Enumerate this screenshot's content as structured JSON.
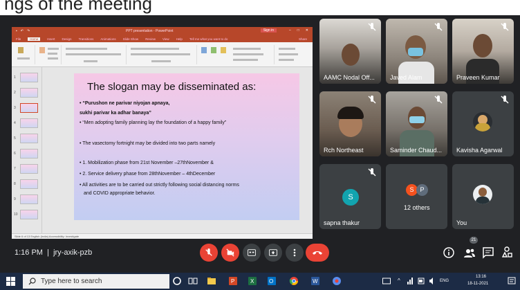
{
  "top_caption": "ngs of the meeting",
  "powerpoint": {
    "title": "PPT presentation - PowerPoint",
    "sign_in": "Sign in",
    "tabs": [
      "File",
      "Home",
      "Insert",
      "Design",
      "Transitions",
      "Animations",
      "Slide Show",
      "Review",
      "View",
      "Help",
      "Tell me what you want to do",
      "Share"
    ],
    "status_text": "Slide 6 of 13   English (India)   Accessibility: Investigate",
    "slide": {
      "title": "The slogan may be disseminated as:",
      "lines": [
        "• “Purushon ne parivar niyojan apnaya,",
        "sukhi parivar ka adhar banaya”",
        "• “Men adopting family planning lay the foundation of a happy family”",
        "• The vasectomy fortnight may be divided into two parts namely",
        "• 1. Mobilization phase from 21st November –27thNovember &",
        "• 2. Service delivery phase from 28thNovember – 4thDecember",
        "• All activities are to be carried out strictly following social distancing norms",
        "and COVID appropriate behavior."
      ]
    }
  },
  "participants": [
    {
      "name": "AAMC Nodal Off..."
    },
    {
      "name": "Javed Alam"
    },
    {
      "name": "Praveen Kumar"
    },
    {
      "name": "Rch Northeast"
    },
    {
      "name": "Saminder Chaud..."
    },
    {
      "name": "Kavisha Agarwal"
    },
    {
      "name": "sapna thakur",
      "initial": "S",
      "color": "#12a4af"
    },
    {
      "name": "12 others",
      "initials": [
        "S",
        "P"
      ],
      "colors": [
        "#f4511e",
        "#5f6c7b"
      ]
    },
    {
      "name": "You"
    }
  ],
  "meeting": {
    "time": "1:16 PM",
    "code": "jry-axik-pzb",
    "participant_count": "21"
  },
  "taskbar": {
    "search_placeholder": "Type here to search",
    "lang": "ENG",
    "clock_time": "13:16",
    "clock_date": "18-11-2021"
  }
}
